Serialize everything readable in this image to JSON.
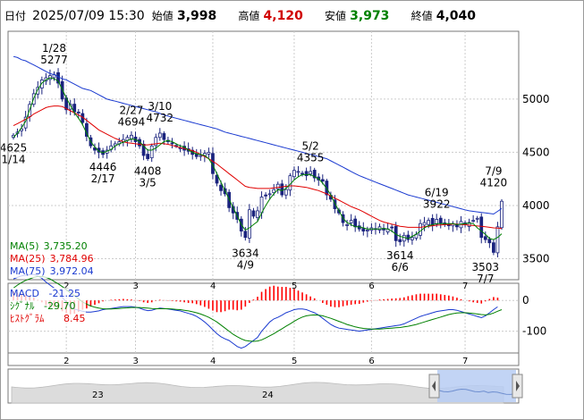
{
  "header": {
    "date_label": "日付",
    "datetime": "2025/07/09 15:30",
    "open_label": "始値",
    "open": "3,998",
    "high_label": "高値",
    "high": "4,120",
    "low_label": "安値",
    "low": "3,973",
    "close_label": "終値",
    "close": "4,040"
  },
  "colors": {
    "high": "#d00000",
    "low": "#008000",
    "up_candle": "#ffffff",
    "down_candle": "#1a237e",
    "ma5": "#008000",
    "ma25": "#e00000",
    "ma75": "#1a3ad0",
    "macd": "#1a3ad0",
    "signal": "#008000",
    "histogram": "#ff0000"
  },
  "legend": [
    {
      "name": "MA(5)",
      "value": "3,735.20",
      "color": "#008000"
    },
    {
      "name": "MA(25)",
      "value": "3,784.96",
      "color": "#e00000"
    },
    {
      "name": "MA(75)",
      "value": "3,972.04",
      "color": "#1a3ad0"
    }
  ],
  "macd_legend": [
    {
      "name": "MACD",
      "value": "-21.25",
      "color": "#1a3ad0"
    },
    {
      "name": "ｼｸﾞﾅﾙ",
      "value": "-29.70",
      "color": "#008000"
    },
    {
      "name": "ﾋｽﾄｸﾞﾗﾑ",
      "value": "8.45",
      "color": "#e00000"
    }
  ],
  "chart_data": {
    "type": "candlestick",
    "y_ticks": [
      5000,
      4500,
      4000,
      3500
    ],
    "y_range": [
      3320,
      5620
    ],
    "x_month_labels": [
      "2",
      "3",
      "4",
      "5",
      "6",
      "7"
    ],
    "macd_ticks": [
      "0",
      "-100"
    ],
    "macd_range": [
      -165,
      50
    ],
    "navigator_labels": [
      "23",
      "24"
    ],
    "annotations": [
      {
        "text": [
          "4625",
          "1/14"
        ],
        "x": 0,
        "y": 4625,
        "pos": "below"
      },
      {
        "text": [
          "1/28",
          "5277"
        ],
        "x": 10,
        "y": 5277,
        "pos": "above"
      },
      {
        "text": [
          "4446",
          "2/17"
        ],
        "x": 22,
        "y": 4446,
        "pos": "below"
      },
      {
        "text": [
          "2/27",
          "4694"
        ],
        "x": 29,
        "y": 4694,
        "pos": "above"
      },
      {
        "text": [
          "4408",
          "3/5"
        ],
        "x": 33,
        "y": 4408,
        "pos": "below"
      },
      {
        "text": [
          "3/10",
          "4732"
        ],
        "x": 36,
        "y": 4732,
        "pos": "above"
      },
      {
        "text": [
          "3634",
          "4/9"
        ],
        "x": 57,
        "y": 3634,
        "pos": "below"
      },
      {
        "text": [
          "5/2",
          "4355"
        ],
        "x": 73,
        "y": 4355,
        "pos": "above"
      },
      {
        "text": [
          "3614",
          "6/6"
        ],
        "x": 95,
        "y": 3614,
        "pos": "below"
      },
      {
        "text": [
          "6/19",
          "3922"
        ],
        "x": 104,
        "y": 3922,
        "pos": "above"
      },
      {
        "text": [
          "3503",
          "7/7"
        ],
        "x": 116,
        "y": 3503,
        "pos": "below"
      },
      {
        "text": [
          "7/9",
          "4120"
        ],
        "x": 118,
        "y": 4120,
        "pos": "above"
      }
    ],
    "month_starts": [
      13,
      30,
      49,
      69,
      88,
      111
    ],
    "closes": [
      4660,
      4690,
      4720,
      4830,
      4950,
      5050,
      5110,
      5180,
      5200,
      5220,
      5230,
      5150,
      5000,
      4900,
      4950,
      4880,
      4870,
      4780,
      4650,
      4560,
      4520,
      4500,
      4480,
      4520,
      4560,
      4580,
      4600,
      4620,
      4640,
      4660,
      4600,
      4560,
      4470,
      4440,
      4560,
      4640,
      4680,
      4620,
      4600,
      4580,
      4560,
      4540,
      4520,
      4510,
      4480,
      4460,
      4470,
      4490,
      4500,
      4300,
      4210,
      4140,
      4110,
      3980,
      3930,
      3870,
      3760,
      3700,
      3960,
      3900,
      3950,
      4080,
      4090,
      4110,
      4150,
      4200,
      4100,
      4150,
      4280,
      4330,
      4320,
      4300,
      4280,
      4320,
      4260,
      4240,
      4230,
      4100,
      4060,
      3970,
      3930,
      3840,
      3820,
      3860,
      3800,
      3780,
      3760,
      3770,
      3790,
      3780,
      3800,
      3770,
      3780,
      3790,
      3670,
      3660,
      3720,
      3680,
      3700,
      3730,
      3830,
      3840,
      3860,
      3810,
      3870,
      3830,
      3820,
      3810,
      3830,
      3800,
      3850,
      3820,
      3840,
      3860,
      3880,
      3700,
      3680,
      3650,
      3560,
      3800,
      4040
    ],
    "ma5": [
      4640,
      4680,
      4730,
      4790,
      4900,
      5010,
      5090,
      5150,
      5180,
      5200,
      5190,
      5170,
      5090,
      5010,
      4940,
      4870,
      4820,
      4760,
      4680,
      4600,
      4550,
      4510,
      4495,
      4510,
      4525,
      4560,
      4580,
      4595,
      4610,
      4625,
      4620,
      4600,
      4560,
      4520,
      4520,
      4540,
      4570,
      4600,
      4610,
      4600,
      4580,
      4560,
      4550,
      4520,
      4500,
      4485,
      4480,
      4470,
      4440,
      4380,
      4300,
      4220,
      4140,
      4060,
      3980,
      3900,
      3820,
      3770,
      3790,
      3820,
      3850,
      3930,
      4000,
      4060,
      4110,
      4150,
      4140,
      4160,
      4200,
      4240,
      4270,
      4290,
      4290,
      4290,
      4270,
      4250,
      4210,
      4160,
      4100,
      4020,
      3950,
      3880,
      3840,
      3820,
      3800,
      3800,
      3790,
      3780,
      3780,
      3780,
      3780,
      3785,
      3780,
      3760,
      3730,
      3710,
      3700,
      3690,
      3710,
      3730,
      3760,
      3790,
      3810,
      3820,
      3830,
      3830,
      3830,
      3830,
      3830,
      3820,
      3825,
      3830,
      3835,
      3830,
      3790,
      3760,
      3730,
      3690,
      3680,
      3700,
      3735
    ],
    "ma25": [
      4750,
      4770,
      4790,
      4810,
      4830,
      4860,
      4880,
      4900,
      4920,
      4930,
      4935,
      4935,
      4930,
      4910,
      4890,
      4870,
      4850,
      4830,
      4800,
      4770,
      4740,
      4710,
      4690,
      4670,
      4650,
      4630,
      4615,
      4600,
      4590,
      4585,
      4580,
      4575,
      4570,
      4570,
      4575,
      4580,
      4585,
      4580,
      4575,
      4565,
      4555,
      4545,
      4535,
      4525,
      4515,
      4500,
      4480,
      4460,
      4440,
      4415,
      4390,
      4360,
      4330,
      4300,
      4270,
      4240,
      4210,
      4180,
      4170,
      4165,
      4160,
      4160,
      4160,
      4160,
      4165,
      4170,
      4175,
      4180,
      4185,
      4185,
      4180,
      4175,
      4170,
      4160,
      4150,
      4140,
      4125,
      4110,
      4090,
      4070,
      4050,
      4030,
      4010,
      3990,
      3975,
      3960,
      3940,
      3920,
      3900,
      3880,
      3860,
      3845,
      3835,
      3825,
      3815,
      3805,
      3800,
      3795,
      3795,
      3795,
      3795,
      3800,
      3805,
      3810,
      3815,
      3818,
      3820,
      3822,
      3825,
      3825,
      3822,
      3820,
      3815,
      3812,
      3808,
      3804,
      3800,
      3795,
      3790,
      3788,
      3785
    ],
    "ma75": [
      5400,
      5390,
      5370,
      5360,
      5340,
      5320,
      5300,
      5280,
      5260,
      5240,
      5230,
      5210,
      5190,
      5180,
      5160,
      5140,
      5120,
      5100,
      5090,
      5080,
      5060,
      5040,
      5020,
      5000,
      4990,
      4980,
      4970,
      4960,
      4950,
      4940,
      4930,
      4920,
      4910,
      4900,
      4890,
      4880,
      4865,
      4850,
      4840,
      4830,
      4820,
      4810,
      4800,
      4790,
      4780,
      4770,
      4760,
      4750,
      4740,
      4730,
      4720,
      4705,
      4690,
      4680,
      4670,
      4660,
      4650,
      4640,
      4630,
      4620,
      4610,
      4600,
      4590,
      4580,
      4570,
      4560,
      4550,
      4540,
      4530,
      4520,
      4510,
      4500,
      4490,
      4480,
      4470,
      4460,
      4450,
      4440,
      4420,
      4400,
      4380,
      4360,
      4340,
      4320,
      4300,
      4280,
      4265,
      4250,
      4235,
      4220,
      4205,
      4190,
      4175,
      4160,
      4145,
      4130,
      4115,
      4100,
      4090,
      4080,
      4070,
      4060,
      4050,
      4040,
      4030,
      4020,
      4010,
      4000,
      3990,
      3980,
      3970,
      3960,
      3950,
      3945,
      3940,
      3935,
      3930,
      3925,
      3920,
      3945,
      3972
    ],
    "macd": [
      70,
      75,
      80,
      82,
      84,
      85,
      80,
      72,
      60,
      50,
      40,
      25,
      10,
      -5,
      -20,
      -28,
      -32,
      -35,
      -38,
      -38,
      -36,
      -34,
      -30,
      -28,
      -26,
      -24,
      -22,
      -20,
      -20,
      -20,
      -22,
      -25,
      -30,
      -33,
      -32,
      -28,
      -25,
      -26,
      -28,
      -30,
      -32,
      -34,
      -38,
      -42,
      -46,
      -52,
      -60,
      -70,
      -82,
      -95,
      -108,
      -118,
      -125,
      -130,
      -140,
      -150,
      -155,
      -150,
      -140,
      -130,
      -120,
      -100,
      -85,
      -70,
      -60,
      -55,
      -48,
      -40,
      -35,
      -30,
      -28,
      -28,
      -30,
      -35,
      -40,
      -48,
      -58,
      -68,
      -78,
      -85,
      -90,
      -92,
      -94,
      -96,
      -98,
      -100,
      -98,
      -96,
      -94,
      -92,
      -90,
      -88,
      -86,
      -84,
      -82,
      -80,
      -76,
      -70,
      -64,
      -58,
      -52,
      -48,
      -44,
      -40,
      -36,
      -34,
      -32,
      -30,
      -30,
      -32,
      -36,
      -40,
      -44,
      -48,
      -52,
      -56,
      -50,
      -40,
      -30,
      -21
    ],
    "signal": [
      40,
      50,
      58,
      65,
      70,
      75,
      78,
      78,
      75,
      70,
      62,
      54,
      45,
      35,
      25,
      15,
      5,
      -5,
      -12,
      -18,
      -22,
      -25,
      -27,
      -28,
      -28,
      -27,
      -26,
      -25,
      -24,
      -23,
      -23,
      -23,
      -24,
      -25,
      -26,
      -27,
      -27,
      -27,
      -27,
      -28,
      -29,
      -30,
      -32,
      -34,
      -37,
      -40,
      -44,
      -49,
      -55,
      -62,
      -70,
      -80,
      -90,
      -100,
      -110,
      -118,
      -125,
      -130,
      -132,
      -133,
      -132,
      -128,
      -122,
      -115,
      -108,
      -100,
      -92,
      -84,
      -76,
      -68,
      -60,
      -54,
      -50,
      -48,
      -47,
      -48,
      -50,
      -54,
      -58,
      -63,
      -68,
      -73,
      -78,
      -82,
      -86,
      -89,
      -91,
      -92,
      -93,
      -93,
      -93,
      -92,
      -91,
      -90,
      -89,
      -88,
      -86,
      -84,
      -81,
      -78,
      -74,
      -70,
      -66,
      -62,
      -58,
      -54,
      -50,
      -46,
      -43,
      -41,
      -40,
      -40,
      -41,
      -42,
      -44,
      -46,
      -47,
      -45,
      -41,
      -35,
      -30
    ],
    "histogram": [
      30,
      25,
      22,
      17,
      14,
      10,
      2,
      -6,
      -15,
      -20,
      -22,
      -29,
      -35,
      -40,
      -45,
      -43,
      -37,
      -30,
      -26,
      -20,
      -14,
      -9,
      -3,
      0,
      2,
      3,
      4,
      5,
      4,
      3,
      1,
      -2,
      -6,
      -8,
      -6,
      -1,
      2,
      1,
      -1,
      -2,
      -3,
      -4,
      -6,
      -8,
      -9,
      -12,
      -16,
      -21,
      -27,
      -33,
      -38,
      -38,
      -35,
      -30,
      -30,
      -32,
      -30,
      -20,
      -8,
      3,
      12,
      28,
      37,
      45,
      48,
      45,
      44,
      44,
      41,
      38,
      32,
      26,
      20,
      13,
      7,
      0,
      -8,
      -14,
      -20,
      -22,
      -22,
      -19,
      -16,
      -14,
      -12,
      -11,
      -7,
      -4,
      -1,
      1,
      3,
      4,
      5,
      6,
      7,
      8,
      10,
      14,
      17,
      20,
      22,
      22,
      22,
      22,
      22,
      20,
      18,
      16,
      13,
      9,
      4,
      0,
      -3,
      -6,
      -8,
      -10,
      -3,
      5,
      11,
      9
    ]
  }
}
